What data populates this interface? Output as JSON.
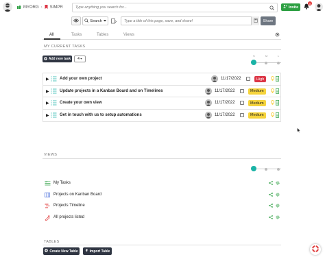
{
  "topbar": {
    "org_label": "MYORG",
    "crumb_sep": "›",
    "project_label": "SIMPR",
    "search_placeholder": "Type anything you search for...",
    "invite_label": "Invite",
    "notification_count": "5"
  },
  "pagebar": {
    "search_label": "Search",
    "page_placeholder": "Type a title of this page, save, and share!",
    "share_label": "Share"
  },
  "tabs": [
    {
      "label": "All",
      "active": true
    },
    {
      "label": "Tasks",
      "active": false
    },
    {
      "label": "Tables",
      "active": false
    },
    {
      "label": "Views",
      "active": false
    }
  ],
  "tasks_section": {
    "title": "MY CURRENT TASKS",
    "add_label": "Add new task",
    "count_value": "4",
    "slider_labels": [
      "S",
      "M",
      "L"
    ],
    "slider_level": 0
  },
  "tasks": [
    {
      "name": "Add your own project",
      "date": "11/17/2022",
      "priority": "High",
      "priority_color": "#dc3545"
    },
    {
      "name": "Update projects in a Kanban Board and on Timelines",
      "date": "11/17/2022",
      "priority": "Medium",
      "priority_color": "#f5d33c"
    },
    {
      "name": "Create your own view",
      "date": "11/17/2022",
      "priority": "Medium",
      "priority_color": "#f5d33c"
    },
    {
      "name": "Get in touch with us to setup automations",
      "date": "11/17/2022",
      "priority": "Medium",
      "priority_color": "#f5d33c"
    }
  ],
  "views_section": {
    "title": "VIEWS",
    "slider_level": 0
  },
  "views": [
    {
      "label": "My Tasks",
      "icon": "tasks-view-icon"
    },
    {
      "label": "Projects on Kanban Board",
      "icon": "kanban-view-icon"
    },
    {
      "label": "Projects Timeline",
      "icon": "timeline-view-icon"
    },
    {
      "label": "All projects listed",
      "icon": "list-view-icon"
    }
  ],
  "tables_section": {
    "title": "TABLES",
    "create_label": "Create New Table",
    "import_label": "Import Table"
  },
  "colors": {
    "accent": "#1ab3a6",
    "invite": "#2ea043",
    "dark_button": "#2f3542"
  }
}
